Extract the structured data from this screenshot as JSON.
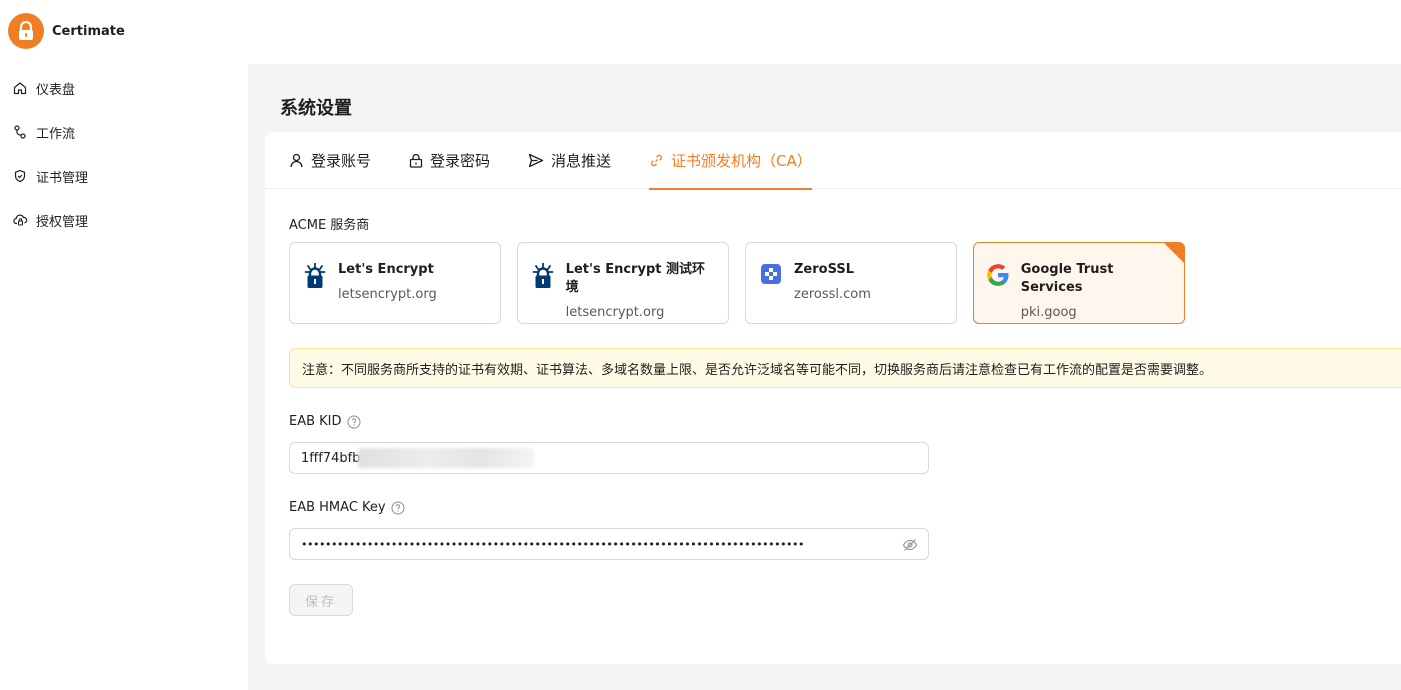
{
  "app": {
    "name": "Certimate",
    "logo_icon": "lock-icon",
    "accent_color": "#f07f23"
  },
  "sidebar": {
    "items": [
      {
        "label": "仪表盘",
        "icon": "home-icon"
      },
      {
        "label": "工作流",
        "icon": "workflow-icon"
      },
      {
        "label": "证书管理",
        "icon": "shield-check-icon"
      },
      {
        "label": "授权管理",
        "icon": "cloud-lock-icon"
      }
    ]
  },
  "page": {
    "title": "系统设置"
  },
  "tabs": [
    {
      "label": "登录账号",
      "icon": "user-icon",
      "active": false
    },
    {
      "label": "登录密码",
      "icon": "lock-icon",
      "active": false
    },
    {
      "label": "消息推送",
      "icon": "send-icon",
      "active": false
    },
    {
      "label": "证书颁发机构（CA）",
      "icon": "link-icon",
      "active": true
    }
  ],
  "acme": {
    "label": "ACME 服务商",
    "providers": [
      {
        "name": "Let's Encrypt",
        "domain": "letsencrypt.org",
        "icon": "letsencrypt-icon",
        "selected": false
      },
      {
        "name": "Let's Encrypt 测试环境",
        "domain": "letsencrypt.org",
        "icon": "letsencrypt-icon",
        "selected": false
      },
      {
        "name": "ZeroSSL",
        "domain": "zerossl.com",
        "icon": "zerossl-icon",
        "selected": false
      },
      {
        "name": "Google Trust Services",
        "domain": "pki.goog",
        "icon": "google-icon",
        "selected": true
      }
    ]
  },
  "notice": {
    "text": "注意：不同服务商所支持的证书有效期、证书算法、多域名数量上限、是否允许泛域名等可能不同，切换服务商后请注意检查已有工作流的配置是否需要调整。"
  },
  "form": {
    "eab_kid": {
      "label": "EAB KID",
      "value": "1fff74bfb",
      "help_icon": "question-circle-icon"
    },
    "eab_hmac": {
      "label": "EAB HMAC Key",
      "value": "••••••••••••••••••••••••••••••••••••••••••••••••••••••••••••••••••••••••••••••••••••",
      "help_icon": "question-circle-icon",
      "toggle_icon": "eye-off-icon"
    },
    "save_label": "保存"
  }
}
